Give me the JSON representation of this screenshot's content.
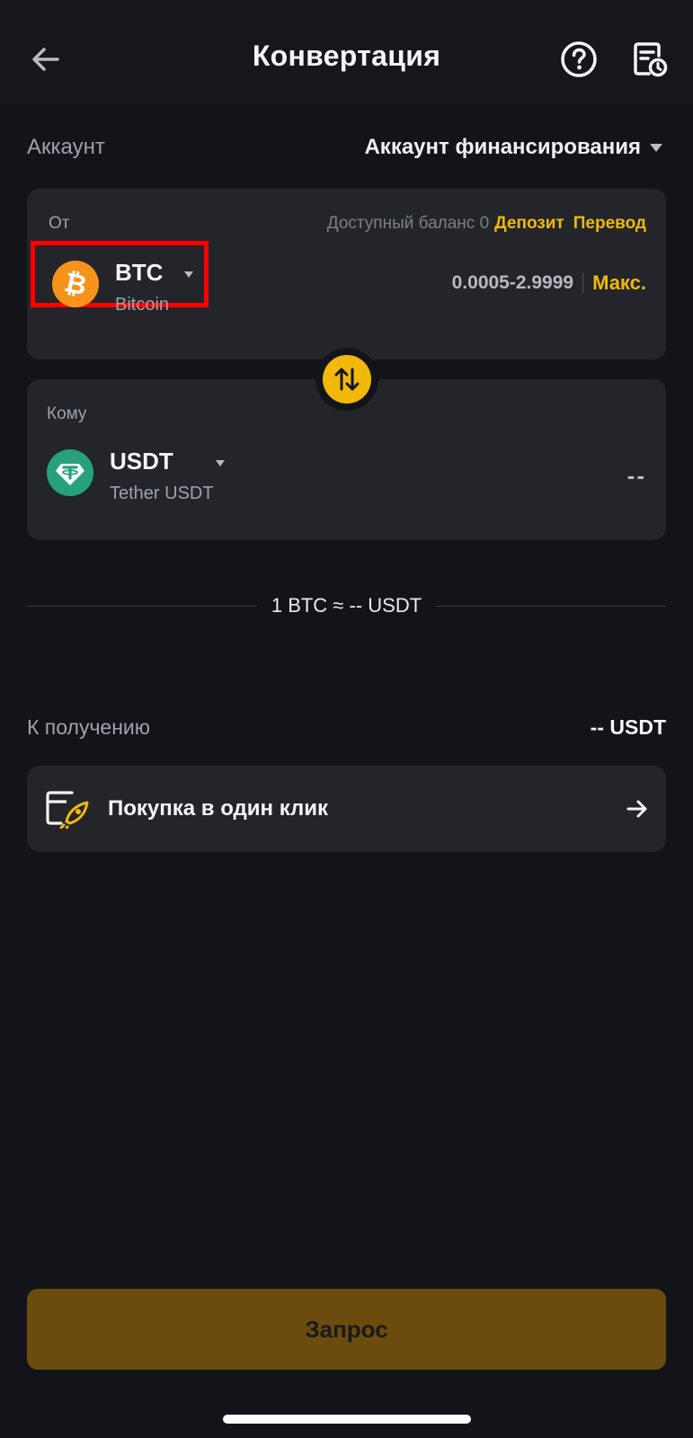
{
  "header": {
    "title": "Конвертация",
    "back_icon": "arrow-left-icon",
    "help_icon": "question-circle-icon",
    "history_icon": "order-history-icon"
  },
  "account": {
    "label": "Аккаунт",
    "value": "Аккаунт финансирования"
  },
  "from": {
    "label": "От",
    "balance_text": "Доступный баланс 0",
    "deposit_label": "Депозит",
    "transfer_label": "Перевод",
    "coin_symbol": "BTC",
    "coin_name": "Bitcoin",
    "range": "0.0005-2.9999",
    "max_label": "Макс."
  },
  "to": {
    "label": "Кому",
    "coin_symbol": "USDT",
    "coin_name": "Tether USDT",
    "amount": "--"
  },
  "rate": "1 BTC ≈ -- USDT",
  "receive": {
    "label": "К получению",
    "value": "-- USDT"
  },
  "one_click": {
    "label": "Покупка в один клик"
  },
  "submit_label": "Запрос",
  "colors": {
    "background": "#131419",
    "card": "#23252b",
    "accent": "#f0b90b",
    "btc": "#f7931a",
    "usdt": "#26a17b",
    "highlight": "#ff0000",
    "button_disabled": "#6b4c0e"
  }
}
